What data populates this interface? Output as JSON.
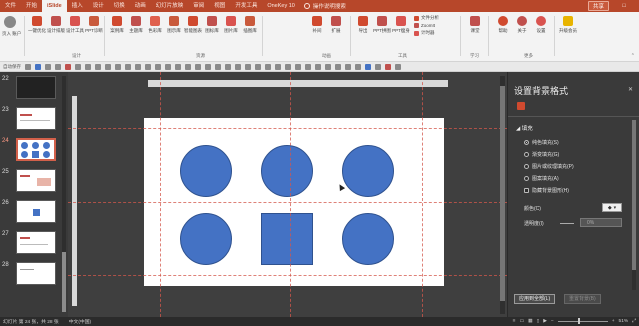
{
  "menubar": {
    "tabs": [
      "文件",
      "开始",
      "iSlide",
      "插入",
      "设计",
      "切换",
      "动画",
      "幻灯片放映",
      "审阅",
      "视图",
      "开发工具",
      "OneKey 10"
    ],
    "active_tab": "iSlide",
    "search_label": "操作说明搜索",
    "share_label": "共享",
    "comment_label": "□"
  },
  "ribbon": {
    "user_label": "页入 账户",
    "design_buttons": [
      "一键优化",
      "设计排版",
      "设计工具",
      "PPT诊断"
    ],
    "design_group": "设计",
    "resource_buttons": [
      "案例库",
      "主题库",
      "色彩库",
      "图示库",
      "智能图表",
      "图标库",
      "图片库",
      "插图库"
    ],
    "resource_group": "资源",
    "anim_buttons": [
      "补间",
      "扩展"
    ],
    "anim_group": "动画",
    "tool_buttons": [
      "导出",
      "PPT拼图",
      "PPT瘦身"
    ],
    "tool_small": [
      "文件分析",
      "ZoomIt",
      "计时器"
    ],
    "tool_group": "工具",
    "learn_buttons": [
      "课堂"
    ],
    "learn_group": "学习",
    "more_buttons": [
      "帮助",
      "关于",
      "设置"
    ],
    "more_group": "更多",
    "upgrade_label": "升级会员"
  },
  "qat": {
    "autosave_label": "自动保存"
  },
  "thumbs": {
    "numbers": [
      "22",
      "23",
      "24",
      "25",
      "26",
      "27",
      "28"
    ],
    "selected": "24"
  },
  "pane": {
    "title": "设置背景格式",
    "section": "◢ 填充",
    "options": [
      {
        "label": "纯色填充(S)",
        "checked": true
      },
      {
        "label": "渐变填充(G)",
        "checked": false
      },
      {
        "label": "图片或纹理填充(P)",
        "checked": false
      },
      {
        "label": "图案填充(A)",
        "checked": false
      },
      {
        "label": "隐藏背景图形(H)",
        "checked": false
      }
    ],
    "color_label": "颜色(C)",
    "transparency_label": "透明度(I)",
    "transparency_value": "0%",
    "apply_all": "应用到全部(L)",
    "reset": "重置背景(B)"
  },
  "status": {
    "slide_info": "幻灯片 第 24 张，共 28 张",
    "language": "中文(中国)",
    "zoom": "51%"
  },
  "colors": {
    "brand": "#b7472a",
    "shape_fill": "#4472c4",
    "guide": "#d4574b"
  }
}
